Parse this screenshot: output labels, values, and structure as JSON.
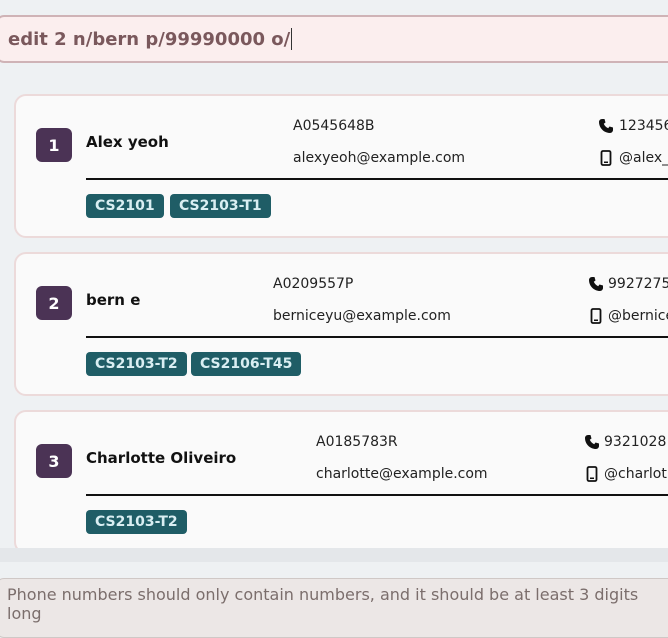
{
  "command_box": {
    "value": "edit 2 n/bern p/99990000 o/"
  },
  "persons": [
    {
      "index": "1",
      "name": "Alex yeoh",
      "matric": "A0545648B",
      "email": "alexyeoh@example.com",
      "phone": "123456",
      "telegram": "@alex_",
      "tags": [
        "CS2101",
        "CS2103-T1"
      ]
    },
    {
      "index": "2",
      "name": "bern e",
      "matric": "A0209557P",
      "email": "berniceyu@example.com",
      "phone": "9927275",
      "telegram": "@bernice",
      "tags": [
        "CS2103-T2",
        "CS2106-T45"
      ]
    },
    {
      "index": "3",
      "name": "Charlotte Oliveiro",
      "matric": "A0185783R",
      "email": "charlotte@example.com",
      "phone": "9321028",
      "telegram": "@charlot",
      "tags": [
        "CS2103-T2"
      ]
    }
  ],
  "result_display": {
    "message": "Phone numbers should only contain numbers, and it should be at least 3 digits long"
  },
  "icons": {
    "phone": "phone-icon",
    "telegram": "mobile-icon"
  },
  "colors": {
    "index_badge": "#4b3355",
    "tag": "#1f5d66",
    "command_text": "#7a585c"
  }
}
